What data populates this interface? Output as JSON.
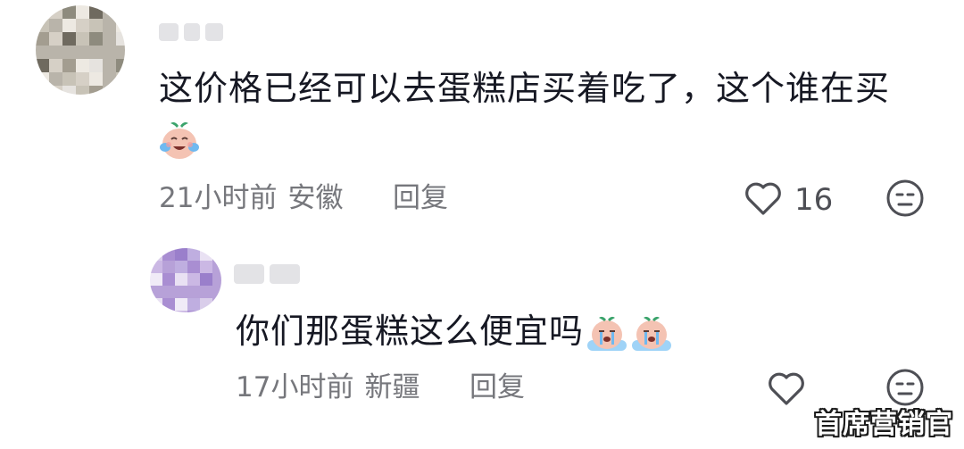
{
  "comments": [
    {
      "text": "这价格已经可以去蛋糕店买着吃了，这个谁在买",
      "emoji": "laughing-crying-baby-emoji",
      "time": "21小时前",
      "location": "安徽",
      "reply_label": "回复",
      "like_count": "16",
      "avatar_colors": [
        "#e6e3df",
        "#b9b4aa",
        "#8e8b7e",
        "#c8c3b7",
        "#6f6a5f",
        "#d6d0c6",
        "#a39d90",
        "#ede9e2"
      ]
    },
    {
      "text": "你们那蛋糕这么便宜吗",
      "emoji": "sobbing-baby-emoji",
      "time": "17小时前",
      "location": "新疆",
      "reply_label": "回复",
      "like_count": "",
      "avatar_colors": [
        "#d9cdea",
        "#b7a1d8",
        "#9a7fcb",
        "#cbb8e4",
        "#e9e1f3",
        "#a98ed2",
        "#f0ebf7",
        "#bfaee0"
      ]
    }
  ],
  "watermark": "首席营销官",
  "colors": {
    "text_primary": "#161823",
    "text_secondary": "#76777c",
    "icon": "#4e4f55"
  }
}
